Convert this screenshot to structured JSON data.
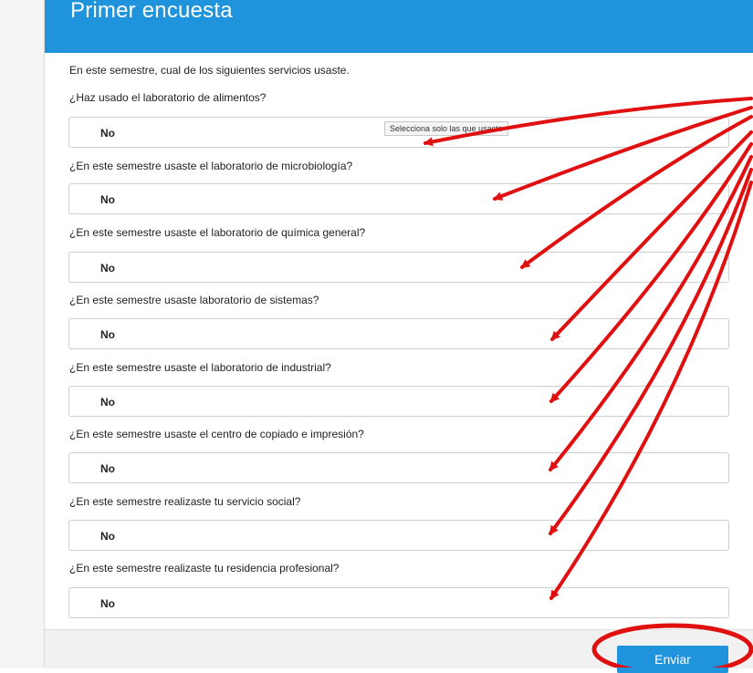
{
  "header": {
    "title": "Primer encuesta"
  },
  "intro": "En este semestre, cual de los siguientes servicios usaste.",
  "tooltip": "Selecciona solo las que usaste",
  "questions": [
    {
      "label": "¿Haz usado el laboratorio de alimentos?",
      "answer": "No"
    },
    {
      "label": "¿En este semestre usaste el laboratorio de microbiología?",
      "answer": "No"
    },
    {
      "label": "¿En este semestre usaste el laboratorio de química general?",
      "answer": "No"
    },
    {
      "label": "¿En este semestre usaste laboratorio de sistemas?",
      "answer": "No"
    },
    {
      "label": "¿En este semestre usaste el laboratorio de industrial?",
      "answer": "No"
    },
    {
      "label": "¿En este semestre usaste el centro de copiado e impresión?",
      "answer": "No"
    },
    {
      "label": "¿En este semestre realizaste tu servicio social?",
      "answer": "No"
    },
    {
      "label": "¿En este semestre realizaste tu residencia profesional?",
      "answer": "No"
    }
  ],
  "footer": {
    "submit_label": "Enviar"
  },
  "colors": {
    "accent": "#1f94dc",
    "annotation": "#e01010"
  }
}
